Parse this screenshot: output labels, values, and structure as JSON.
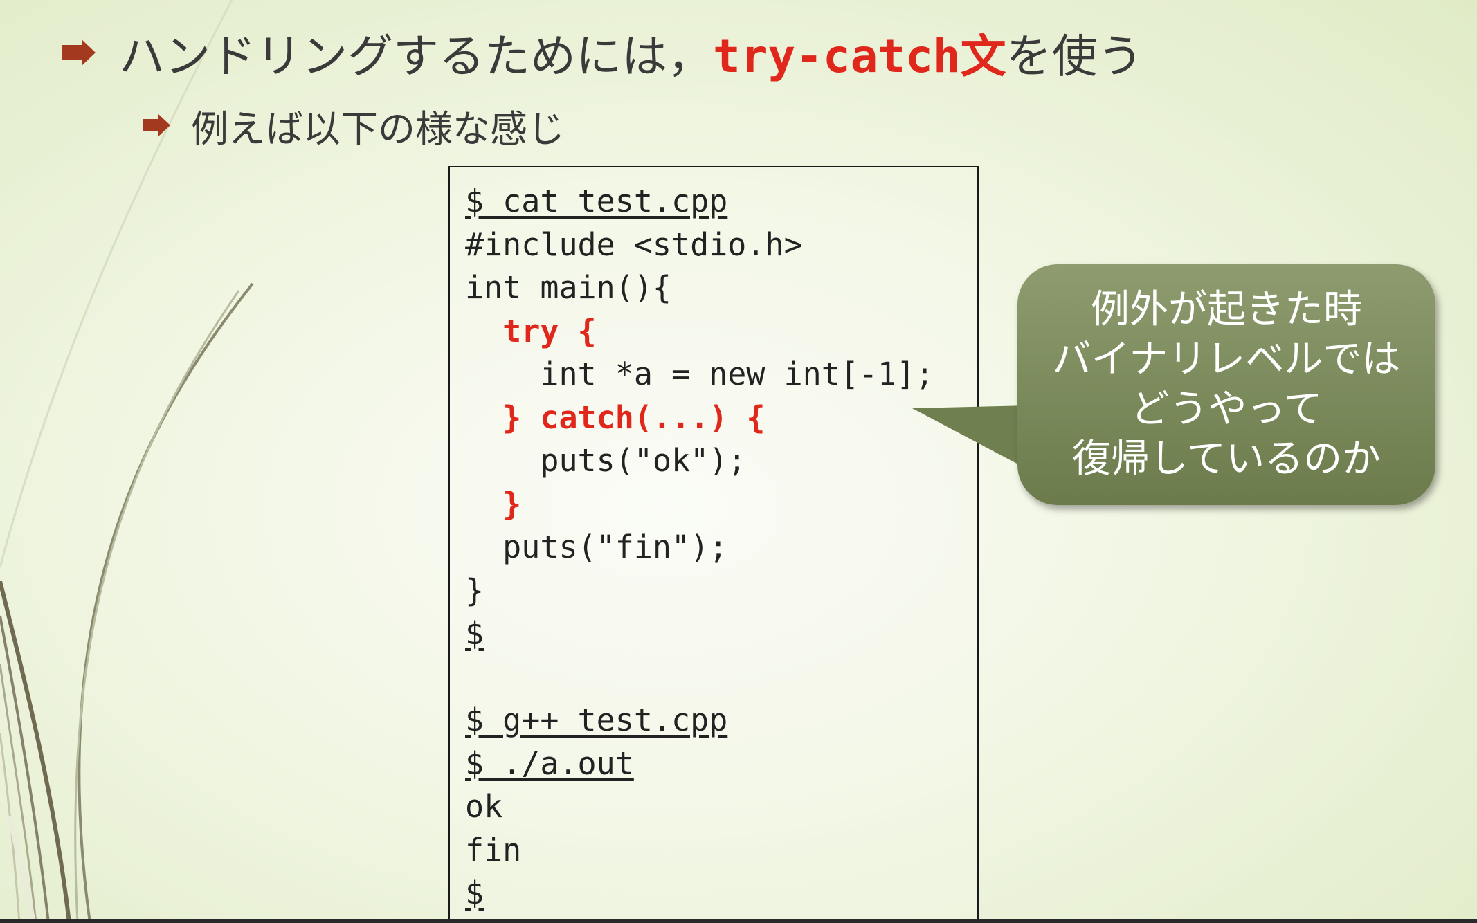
{
  "slide": {
    "bullet1": {
      "prefix": "ハンドリングするためには，",
      "highlight_code": "try-catch",
      "highlight_text": "文",
      "suffix": "を使う"
    },
    "bullet2": {
      "text": "例えば以下の様な感じ"
    },
    "code_block": {
      "lines": [
        {
          "text": "$ cat test.cpp",
          "style": "underline"
        },
        {
          "text": "#include <stdio.h>",
          "style": "normal"
        },
        {
          "text": "int main(){",
          "style": "normal"
        },
        {
          "text": "  try {",
          "style": "keyword"
        },
        {
          "text": "    int *a = new int[-1];",
          "style": "normal"
        },
        {
          "text": "  } catch(...) {",
          "style": "keyword"
        },
        {
          "text": "    puts(\"ok\");",
          "style": "normal"
        },
        {
          "text": "  }",
          "style": "keyword"
        },
        {
          "text": "  puts(\"fin\");",
          "style": "normal"
        },
        {
          "text": "}",
          "style": "normal"
        },
        {
          "text": "$",
          "style": "underline"
        },
        {
          "text": "",
          "style": "normal"
        },
        {
          "text": "$ g++ test.cpp",
          "style": "underline"
        },
        {
          "text": "$ ./a.out",
          "style": "underline"
        },
        {
          "text": "ok",
          "style": "normal"
        },
        {
          "text": "fin",
          "style": "normal"
        },
        {
          "text": "$",
          "style": "underline"
        }
      ]
    },
    "callout": {
      "lines": [
        "例外が起きた時",
        "バイナリレベルでは",
        "どうやって",
        "復帰しているのか"
      ]
    }
  },
  "colors": {
    "bullet_arrow": "#a33a1f",
    "highlight": "#e0271c",
    "callout_fill": "#7a8a5a"
  },
  "icons": {
    "bullet": "arrow-right-icon"
  }
}
